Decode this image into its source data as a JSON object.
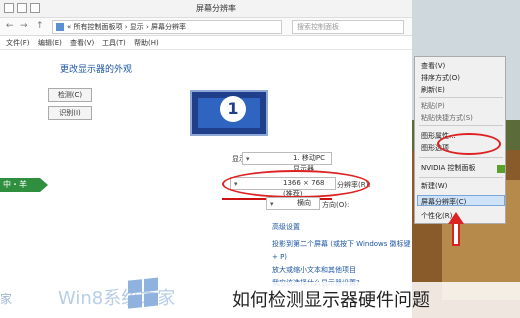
{
  "window": {
    "title": "屏幕分辨率",
    "address": "« 所有控制面板项 › 显示 › 屏幕分辨率",
    "search_placeholder": "搜索控制面板",
    "nav_back": "←",
    "nav_forward": "→",
    "nav_up": "↑"
  },
  "menu": [
    "文件(F)",
    "编辑(E)",
    "查看(V)",
    "工具(T)",
    "帮助(H)"
  ],
  "main": {
    "heading": "更改显示器的外观",
    "detect_label": "检测(C)",
    "identify_label": "识别(I)",
    "monitor_number": "1",
    "display_label": "显示器(S):",
    "display_value": "1. 移动PC显示器",
    "resolution_label": "分辨率(R):",
    "resolution_value": "1366 × 768 (推荐)",
    "orientation_label": "方向(O):",
    "orientation_value": "横向",
    "advanced_link": "高级设置",
    "link1": "投影到第二个屏幕 (或按下 Windows 徽标键 + P)",
    "link2": "放大或缩小文本和其他项目",
    "link3": "我应该选择什么显示器设置?"
  },
  "context_menu": {
    "items": [
      {
        "label": "查看(V)",
        "dim": false
      },
      {
        "label": "排序方式(O)",
        "dim": false
      },
      {
        "label": "刷新(E)",
        "dim": false
      },
      {
        "label": "粘贴(P)",
        "dim": true
      },
      {
        "label": "粘贴快捷方式(S)",
        "dim": true
      },
      {
        "label": "图形属性...",
        "dim": false
      },
      {
        "label": "图形选项",
        "dim": false
      },
      {
        "label": "NVIDIA 控制面板",
        "dim": false
      },
      {
        "label": "新建(W)",
        "dim": false
      },
      {
        "label": "屏幕分辨率(C)",
        "dim": false
      },
      {
        "label": "个性化(R)",
        "dim": false
      }
    ]
  },
  "overlay": {
    "green_tag": "中・羊",
    "watermark_left": "家",
    "watermark_main": "Win8系统之家",
    "caption": "如何检测显示器硬件问题"
  },
  "colors": {
    "accent": "#1d56a5",
    "highlight_red": "#d22222",
    "green_tag": "#2f8f3f"
  }
}
